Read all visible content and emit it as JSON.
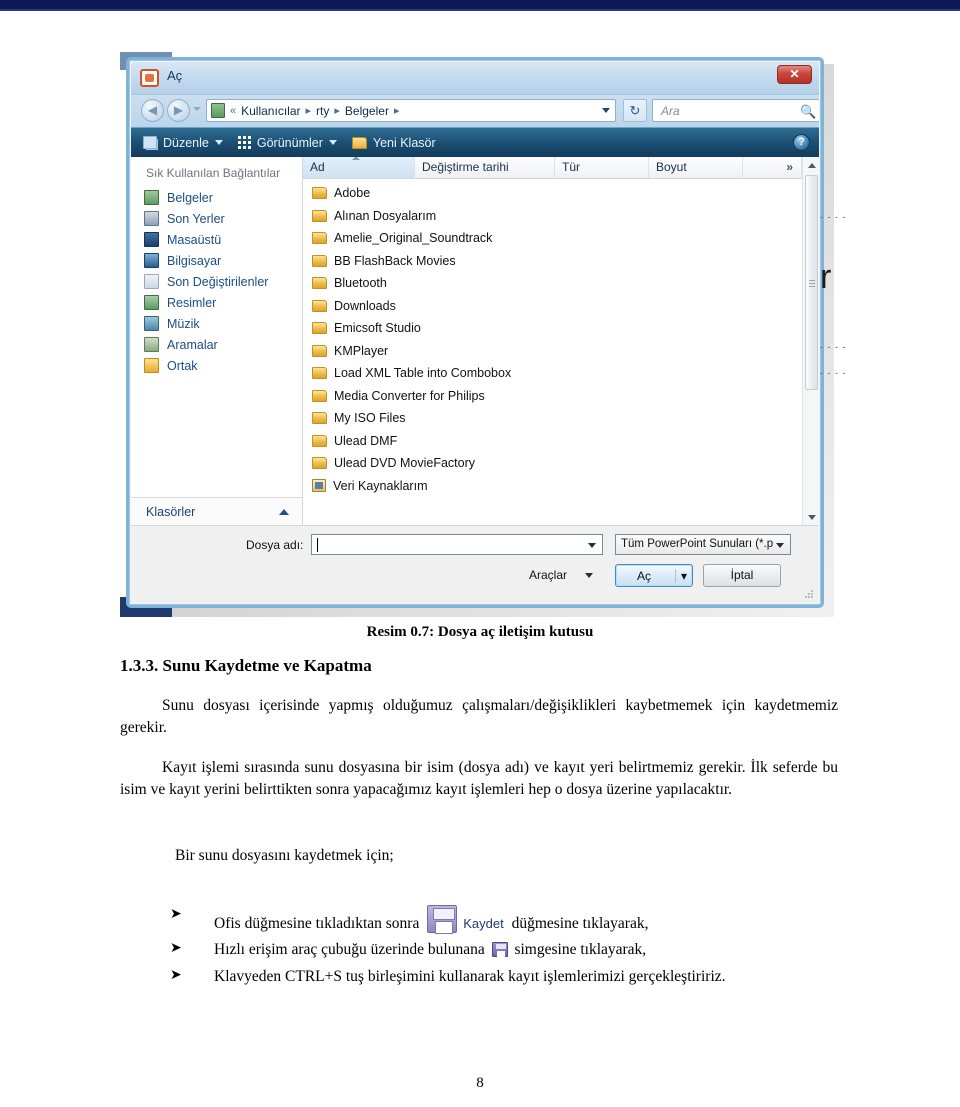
{
  "document": {
    "caption": "Resim 0.7:  Dosya aç iletişim kutusu",
    "heading": "1.3.3. Sunu Kaydetme ve Kapatma",
    "paragraph1": "Sunu dosyası içerisinde yapmış olduğumuz çalışmaları/değişiklikleri kaybetmemek için kaydetmemiz gerekir.",
    "paragraph2": "Kayıt işlemi sırasında sunu dosyasına bir isim (dosya adı) ve kayıt yeri belirtmemiz gerekir. İlk seferde bu isim ve kayıt yerini belirttikten sonra yapacağımız kayıt işlemleri hep o dosya üzerine yapılacaktır.",
    "paragraph3": "Bir sunu dosyasını kaydetmek için;",
    "bullets": [
      {
        "marker": "➤",
        "pre": "Ofis düğmesine tıkladıktan sonra ",
        "icon_label": "Kaydet",
        "post": " düğmesine tıklayarak,"
      },
      {
        "marker": "➤",
        "pre": "Hızlı erişim araç çubuğu üzerinde bulunana ",
        "icon_label": "",
        "post": " simgesine tıklayarak,"
      },
      {
        "marker": "➤",
        "pre": "Klavyeden CTRL+S tuş birleşimini kullanarak kayıt işlemlerimizi gerçekleştiririz.",
        "icon_label": "",
        "post": ""
      }
    ],
    "page_number": "8",
    "margin_artifact": "r"
  },
  "dialog": {
    "title": "Aç",
    "close_label": "✕",
    "nav": {
      "back_label": "◀",
      "forward_label": "▶",
      "breadcrumb": [
        "Kullanıcılar",
        "rty",
        "Belgeler"
      ],
      "breadcrumb_prefix": "«",
      "breadcrumb_sep": "▸",
      "refresh_label": "↻"
    },
    "search": {
      "placeholder": "Ara",
      "value": "",
      "icon": "search-icon"
    },
    "commandbar": {
      "organize": "Düzenle",
      "views": "Görünümler",
      "new_folder": "Yeni Klasör",
      "help_label": "?"
    },
    "sidebar": {
      "header": "Sık Kullanılan Bağlantılar",
      "items": [
        {
          "label": "Belgeler",
          "icon": "documents-icon",
          "cls": "docs"
        },
        {
          "label": "Son Yerler",
          "icon": "recent-places-icon",
          "cls": "recent"
        },
        {
          "label": "Masaüstü",
          "icon": "desktop-icon",
          "cls": "desktop"
        },
        {
          "label": "Bilgisayar",
          "icon": "computer-icon",
          "cls": "pc"
        },
        {
          "label": "Son Değiştirilenler",
          "icon": "recently-changed-icon",
          "cls": "changed"
        },
        {
          "label": "Resimler",
          "icon": "pictures-icon",
          "cls": "pics"
        },
        {
          "label": "Müzik",
          "icon": "music-icon",
          "cls": "music"
        },
        {
          "label": "Aramalar",
          "icon": "searches-icon",
          "cls": "search"
        },
        {
          "label": "Ortak",
          "icon": "public-folder-icon",
          "cls": "shared"
        }
      ],
      "footer": "Klasörler",
      "footer_chevron": "chevron-up-icon"
    },
    "filelist": {
      "columns": [
        "Ad",
        "Değiştirme tarihi",
        "Tür",
        "Boyut",
        "»"
      ],
      "sorted_by": "Ad",
      "rows": [
        {
          "name": "Adobe",
          "icon": "folder-icon"
        },
        {
          "name": "Alınan Dosyalarım",
          "icon": "folder-icon"
        },
        {
          "name": "Amelie_Original_Soundtrack",
          "icon": "folder-icon"
        },
        {
          "name": "BB FlashBack Movies",
          "icon": "folder-icon"
        },
        {
          "name": "Bluetooth",
          "icon": "folder-icon"
        },
        {
          "name": "Downloads",
          "icon": "folder-icon"
        },
        {
          "name": "Emicsoft Studio",
          "icon": "folder-icon"
        },
        {
          "name": "KMPlayer",
          "icon": "folder-icon"
        },
        {
          "name": "Load XML Table into Combobox",
          "icon": "folder-icon"
        },
        {
          "name": "Media Converter for Philips",
          "icon": "folder-icon"
        },
        {
          "name": "My ISO Files",
          "icon": "folder-icon"
        },
        {
          "name": "Ulead DMF",
          "icon": "folder-icon"
        },
        {
          "name": "Ulead DVD MovieFactory",
          "icon": "folder-icon"
        },
        {
          "name": "Veri Kaynaklarım",
          "icon": "datasource-icon"
        }
      ]
    },
    "footer": {
      "filename_label": "Dosya adı:",
      "filename_value": "",
      "filter_value": "Tüm PowerPoint Sunuları (*.p",
      "tools_label": "Araçlar",
      "open_label": "Aç",
      "cancel_label": "İptal"
    }
  },
  "colors": {
    "rule": "#0d1a55",
    "titlebar": "#bdd5ea",
    "commandbar": "#1c4f73",
    "accent_blue": "#1c4d86",
    "folder": "#eab945",
    "close_red": "#c8463c"
  }
}
